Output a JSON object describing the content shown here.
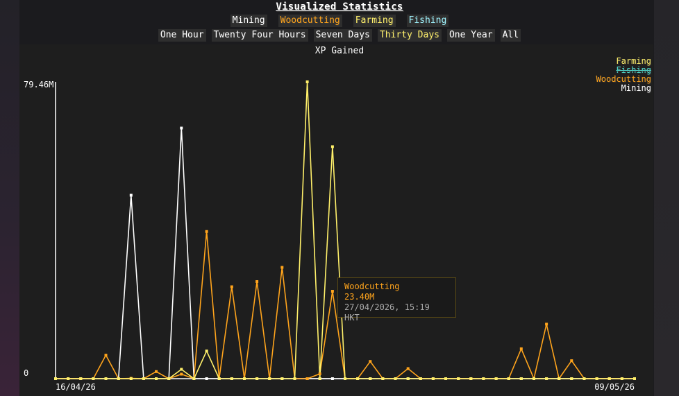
{
  "page_title": "Visualized Statistics",
  "skills": [
    {
      "label": "Mining",
      "color": "#ffffff"
    },
    {
      "label": "Woodcutting",
      "color": "#ffa41c"
    },
    {
      "label": "Farming",
      "color": "#fff06a"
    },
    {
      "label": "Fishing",
      "color": "#9ff4ff"
    }
  ],
  "ranges": [
    {
      "label": "One Hour",
      "active": false
    },
    {
      "label": "Twenty Four Hours",
      "active": false
    },
    {
      "label": "Seven Days",
      "active": false
    },
    {
      "label": "Thirty Days",
      "active": true
    },
    {
      "label": "One Year",
      "active": false
    },
    {
      "label": "All",
      "active": false
    }
  ],
  "colors": {
    "mining": "#ffffff",
    "woodcutting": "#ffa41c",
    "farming": "#fff06a",
    "fishing": "#4fdcd0",
    "active_range": "#fff06a"
  },
  "legend": [
    {
      "label": "Farming",
      "color": "#fff06a",
      "hidden": false
    },
    {
      "label": "Fishing",
      "color": "#4fdcd0",
      "hidden": true
    },
    {
      "label": "Woodcutting",
      "color": "#ffa41c",
      "hidden": false
    },
    {
      "label": "Mining",
      "color": "#ffffff",
      "hidden": false
    }
  ],
  "tooltip": {
    "series": "Woodcutting",
    "value": "23.40M",
    "date": "27/04/2026, 15:19 HKT"
  },
  "chart_data": {
    "type": "line",
    "title": "XP Gained",
    "y_tick_labels": [
      "0",
      "79.46M"
    ],
    "x_tick_labels": [
      "16/04/26",
      "09/05/26"
    ],
    "ylim": [
      0,
      79.46
    ],
    "y_unit": "M",
    "n_points": 47,
    "grid": false,
    "legend_position": "top-right",
    "series": [
      {
        "name": "Mining",
        "color": "#ffffff",
        "values": [
          0,
          0,
          0,
          0,
          0,
          0,
          49.1,
          0,
          0,
          0,
          67.1,
          0,
          0,
          0,
          0,
          0,
          0,
          0,
          0,
          0,
          0,
          0,
          0,
          0,
          0,
          0,
          0,
          0,
          0,
          0,
          0,
          0,
          0,
          0,
          0,
          0,
          0,
          0,
          0,
          0,
          0,
          0,
          0,
          0,
          0,
          0,
          0
        ]
      },
      {
        "name": "Woodcutting",
        "color": "#ffa41c",
        "values": [
          0,
          0,
          0,
          0,
          6.3,
          0,
          0.1,
          0,
          1.9,
          0,
          1.2,
          0,
          39.4,
          0,
          24.6,
          0,
          26.0,
          0,
          29.8,
          0,
          0,
          1.3,
          23.4,
          0,
          0,
          4.6,
          0,
          0,
          2.7,
          0,
          0,
          0,
          0,
          0,
          0,
          0,
          0,
          8.0,
          0,
          14.6,
          0,
          4.8,
          0,
          0,
          0,
          0,
          0
        ]
      },
      {
        "name": "Farming",
        "color": "#fff06a",
        "values": [
          0,
          0,
          0,
          0,
          0,
          0,
          0,
          0,
          0,
          0,
          2.5,
          0,
          7.4,
          0,
          0,
          0,
          0,
          0,
          0,
          0,
          79.46,
          0,
          62.1,
          0,
          0,
          0,
          0,
          0,
          0,
          0,
          0,
          0,
          0,
          0,
          0,
          0,
          0,
          0,
          0,
          0,
          0,
          0,
          0,
          0,
          0,
          0,
          0
        ]
      }
    ]
  }
}
